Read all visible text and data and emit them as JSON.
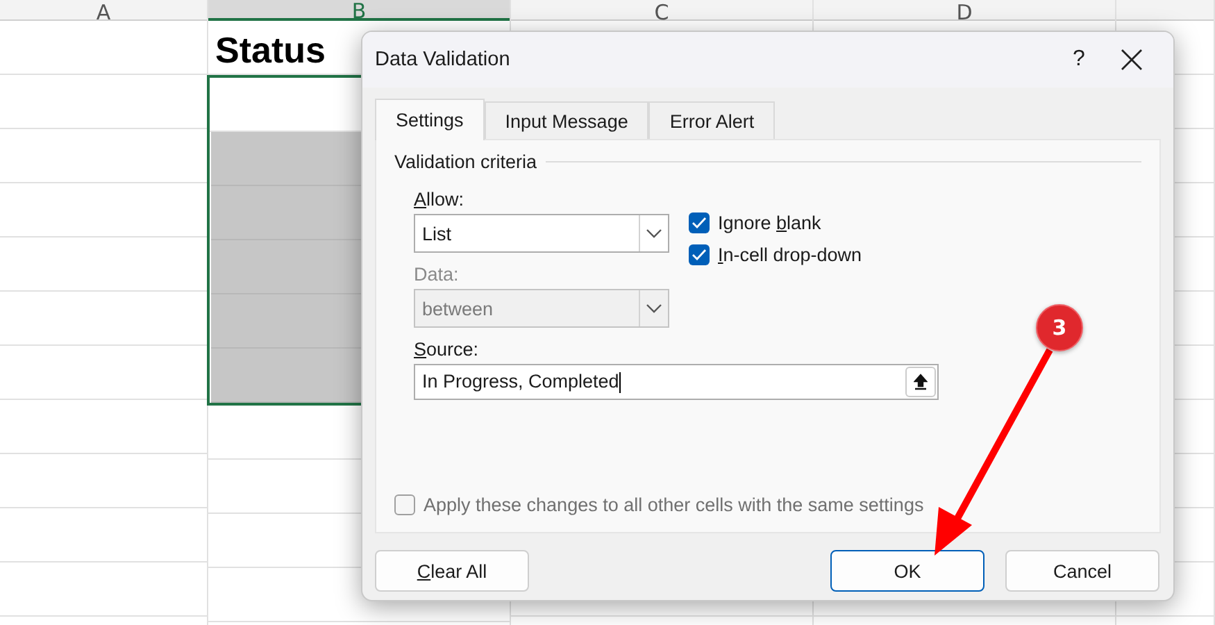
{
  "sheet": {
    "columns": [
      {
        "label": "A",
        "selected": false
      },
      {
        "label": "B",
        "selected": true
      },
      {
        "label": "C",
        "selected": false
      },
      {
        "label": "D",
        "selected": false
      }
    ],
    "header_cell": "Status"
  },
  "dialog": {
    "title": "Data Validation",
    "help": "?",
    "tabs": [
      {
        "label": "Settings",
        "selected": true
      },
      {
        "label": "Input Message",
        "selected": false
      },
      {
        "label": "Error Alert",
        "selected": false
      }
    ],
    "group_title": "Validation criteria",
    "allow": {
      "label_parts": [
        {
          "text": "A",
          "underline": true
        },
        {
          "text": "llow:",
          "underline": false
        }
      ],
      "value": "List",
      "disabled": false
    },
    "data": {
      "label": "Data:",
      "value": "between",
      "disabled": true
    },
    "checkboxes": [
      {
        "label_parts": [
          {
            "text": "Ignore ",
            "underline": false
          },
          {
            "text": "b",
            "underline": true
          },
          {
            "text": "lank",
            "underline": false
          }
        ],
        "checked": true
      },
      {
        "label_parts": [
          {
            "text": "I",
            "underline": true
          },
          {
            "text": "n-cell drop-down",
            "underline": false
          }
        ],
        "checked": true
      }
    ],
    "source": {
      "label_parts": [
        {
          "text": "S",
          "underline": true
        },
        {
          "text": "ource:",
          "underline": false
        }
      ],
      "value": "In Progress, Completed"
    },
    "apply": {
      "label": "Apply these changes to all other cells with the same settings",
      "checked": false,
      "disabled": true
    },
    "buttons": [
      {
        "label_parts": [
          {
            "text": "C",
            "underline": true
          },
          {
            "text": "lear All",
            "underline": false
          }
        ],
        "default": false
      },
      {
        "label": "OK",
        "default": true
      },
      {
        "label": "Cancel",
        "default": false
      }
    ]
  },
  "annotation": {
    "number": "3"
  }
}
